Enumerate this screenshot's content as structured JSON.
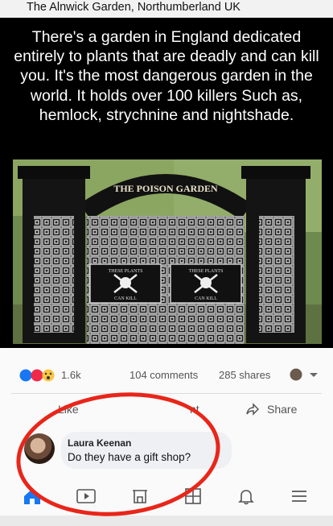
{
  "top_caption": "The Alnwick Garden, Northumberland UK",
  "meme_text": "There's a garden in England dedicated entirely to plants that are deadly and can kill you. It's the most dangerous garden in the world. It holds over 100 killers Such as, hemlock, strychnine and nightshade.",
  "gate": {
    "sign": "THE POISON GARDEN",
    "left_panel_top": "THESE PLANTS",
    "left_panel_bottom": "CAN KILL",
    "right_panel_top": "THESE PLANTS",
    "right_panel_bottom": "CAN KILL"
  },
  "post": {
    "reaction_count": "1.6k",
    "comments": "104 comments",
    "shares": "285 shares"
  },
  "actions": {
    "like": "Like",
    "comment": "nt",
    "share": "Share"
  },
  "comment": {
    "name": "Laura Keenan",
    "text": "Do they have a gift shop?"
  },
  "colors": {
    "accent": "#1877f2",
    "annotation": "#e8261a"
  },
  "tab_icons": [
    "home-icon",
    "video-icon",
    "marketplace-icon",
    "pages-icon",
    "bell-icon",
    "menu-icon"
  ]
}
